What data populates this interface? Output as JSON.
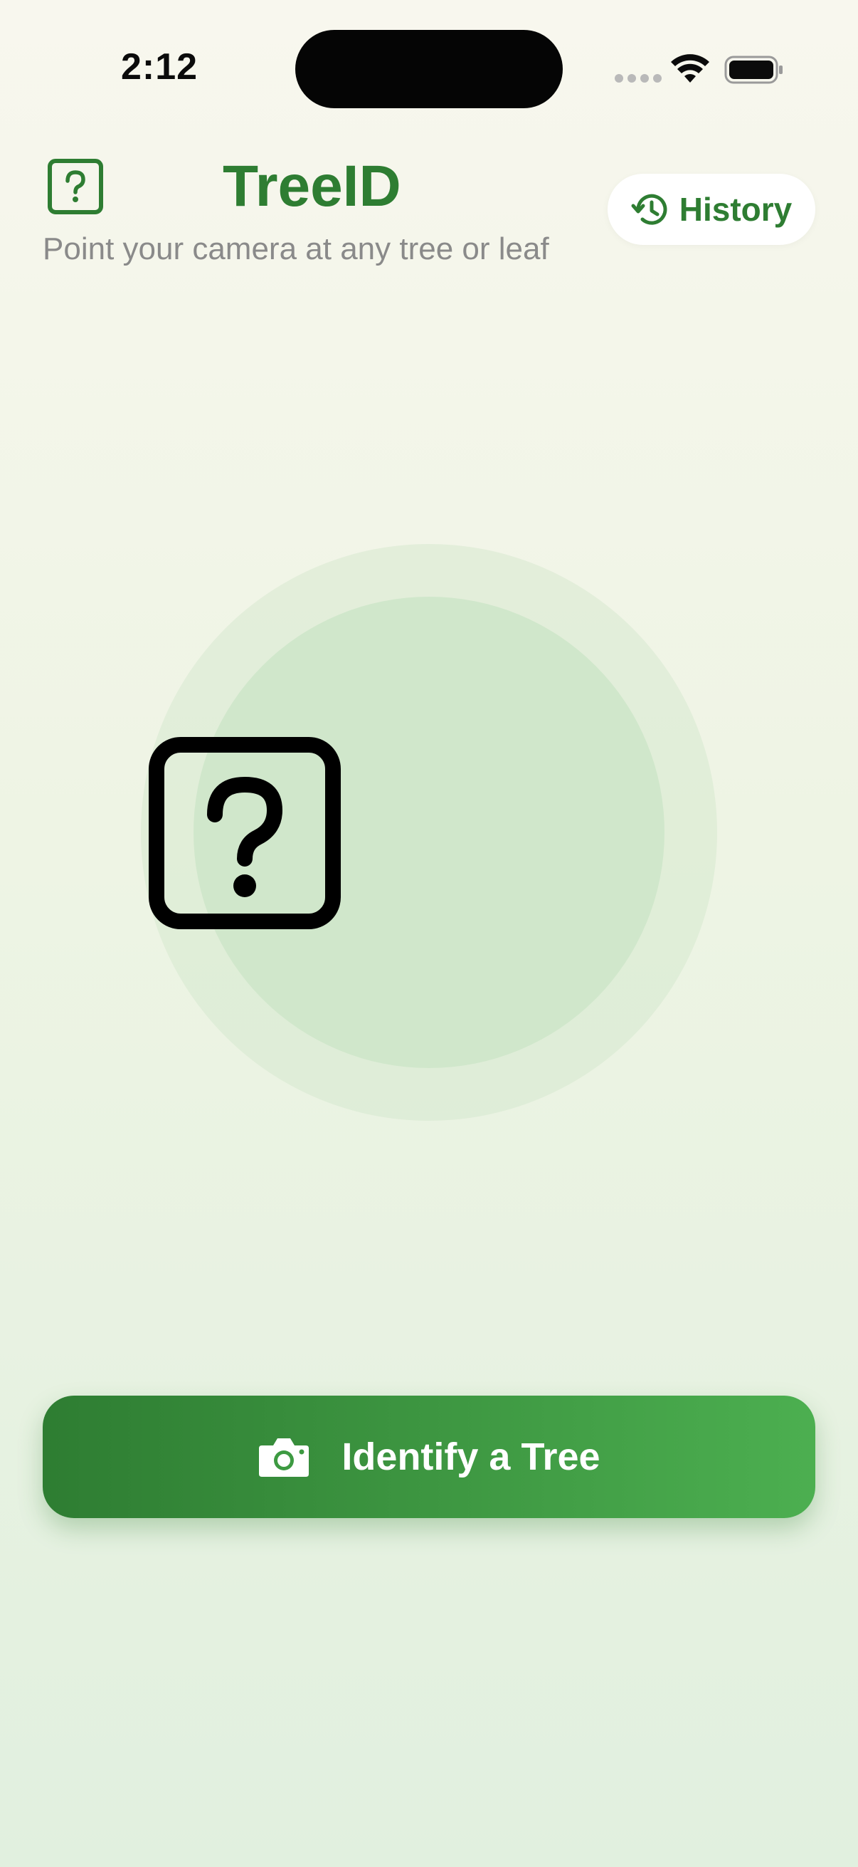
{
  "status_bar": {
    "time": "2:12"
  },
  "header": {
    "title": "TreeID",
    "subtitle": "Point your camera at any tree or leaf",
    "icon": "question-square-icon"
  },
  "history_button": {
    "label": "History",
    "icon": "clock-history-icon"
  },
  "main": {
    "placeholder_icon": "question-square-icon"
  },
  "identify_button": {
    "label": "Identify a Tree",
    "icon": "camera-icon"
  },
  "colors": {
    "brand_green": "#2e7d32",
    "accent_green": "#4caf50",
    "subtitle_gray": "#8a8a8a"
  }
}
